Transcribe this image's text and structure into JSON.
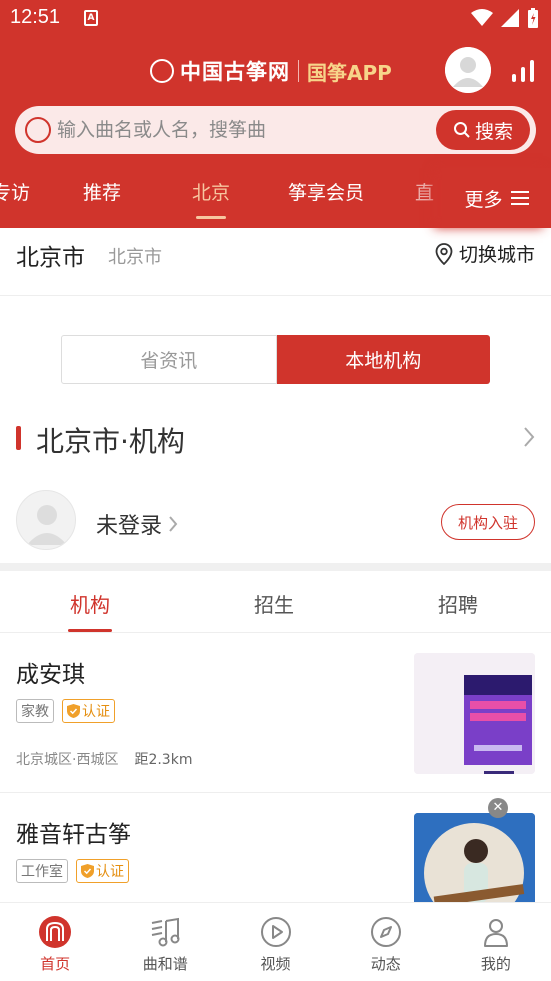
{
  "statusbar": {
    "time": "12:51",
    "app_badge": "A"
  },
  "header": {
    "brand_name": "中国古筝网",
    "app_name": "国筝APP"
  },
  "search": {
    "placeholder": "输入曲名或人名，搜筝曲",
    "button_label": "搜索"
  },
  "nav_tabs": [
    {
      "label": "专访",
      "active": false
    },
    {
      "label": "推荐",
      "active": false
    },
    {
      "label": "北京",
      "active": true
    },
    {
      "label": "筝享会员",
      "active": false
    },
    {
      "label": "直",
      "active": false
    }
  ],
  "more_label": "更多",
  "city": {
    "name": "北京市",
    "sub": "北京市",
    "switch_label": "切换城市"
  },
  "segment": {
    "left": "省资讯",
    "right": "本地机构",
    "active": "right"
  },
  "section_title": "北京市·机构",
  "user": {
    "name": "未登录",
    "join_button": "机构入驻"
  },
  "sub_tabs": [
    {
      "label": "机构",
      "active": true
    },
    {
      "label": "招生",
      "active": false
    },
    {
      "label": "招聘",
      "active": false
    }
  ],
  "listings": [
    {
      "title": "成安琪",
      "type_tag": "家教",
      "cert_tag": "认证",
      "area": "北京城区·西城区",
      "distance": "距2.3km"
    },
    {
      "title": "雅音轩古筝",
      "type_tag": "工作室",
      "cert_tag": "认证"
    }
  ],
  "bottom_nav": [
    {
      "label": "首页",
      "icon": "home-logo-icon",
      "active": true
    },
    {
      "label": "曲和谱",
      "icon": "music-score-icon",
      "active": false
    },
    {
      "label": "视频",
      "icon": "play-icon",
      "active": false
    },
    {
      "label": "动态",
      "icon": "compass-icon",
      "active": false
    },
    {
      "label": "我的",
      "icon": "person-icon",
      "active": false
    }
  ],
  "colors": {
    "primary": "#d0342c",
    "accent_gold": "#f7d48a",
    "cert_orange": "#e58f10"
  }
}
